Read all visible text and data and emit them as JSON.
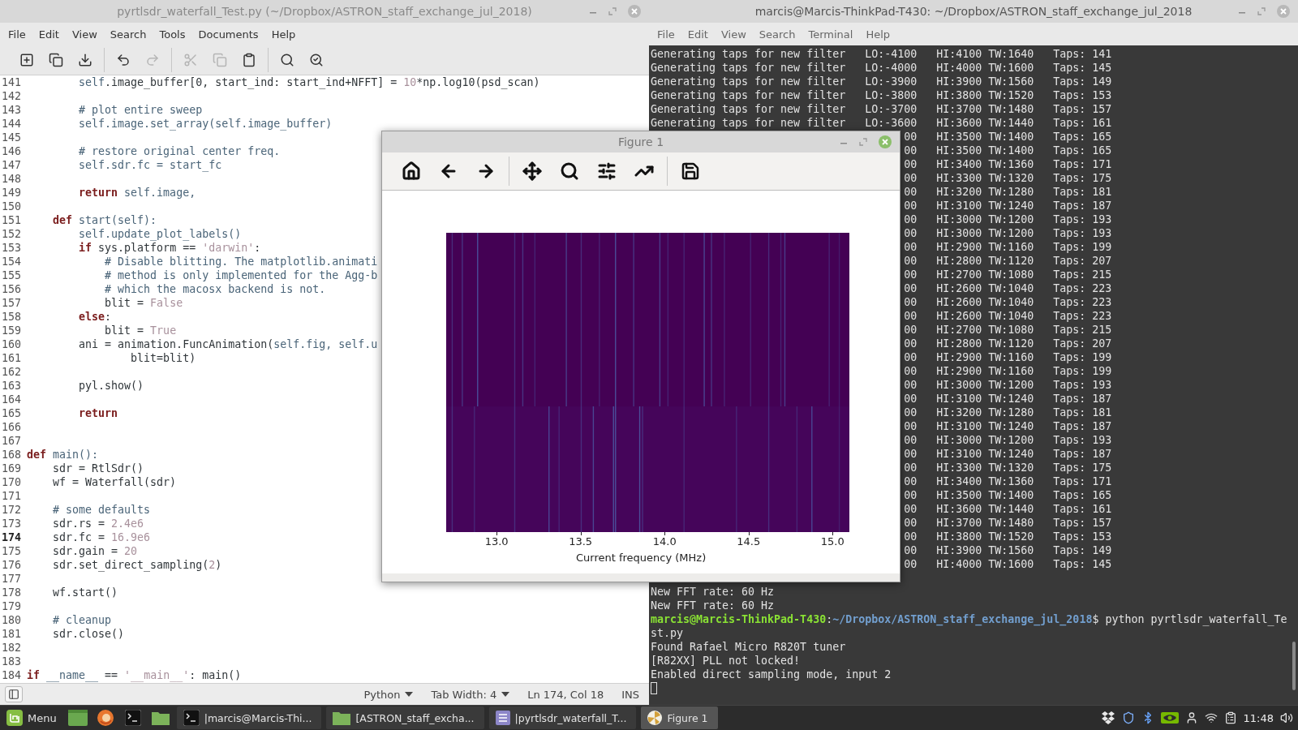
{
  "editor": {
    "title": "pyrtlsdr_waterfall_Test.py (~/Dropbox/ASTRON_staff_exchange_jul_2018)",
    "menu": [
      "File",
      "Edit",
      "View",
      "Search",
      "Tools",
      "Documents",
      "Help"
    ],
    "toolbar": [
      [
        {
          "kind": "new",
          "disabled": false
        },
        {
          "kind": "open",
          "disabled": false
        },
        {
          "kind": "save",
          "disabled": false
        }
      ],
      [
        {
          "kind": "undo",
          "disabled": false
        },
        {
          "kind": "redo",
          "disabled": true
        }
      ],
      [
        {
          "kind": "cut",
          "disabled": true
        },
        {
          "kind": "copy",
          "disabled": true
        },
        {
          "kind": "paste",
          "disabled": false
        }
      ],
      [
        {
          "kind": "search",
          "disabled": false
        },
        {
          "kind": "replace",
          "disabled": false
        }
      ]
    ],
    "lines": [
      {
        "n": "141",
        "current": false,
        "tokens": [
          {
            "kind": "name",
            "text": "        self"
          },
          {
            "kind": "plain",
            "text": ".image_buffer[0, start_ind: start_ind+NFFT] = "
          },
          {
            "kind": "literal",
            "text": "10"
          },
          {
            "kind": "plain",
            "text": "*np.log10(psd_scan)"
          }
        ]
      },
      {
        "n": "142",
        "current": false
      },
      {
        "n": "143",
        "current": false,
        "tokens": [
          {
            "kind": "comment",
            "text": "        # plot entire sweep"
          }
        ]
      },
      {
        "n": "144",
        "current": false,
        "tokens": [
          {
            "kind": "name",
            "text": "        self.image.set_array(self.image_buffer)"
          }
        ]
      },
      {
        "n": "145",
        "current": false
      },
      {
        "n": "146",
        "current": false,
        "tokens": [
          {
            "kind": "comment",
            "text": "        # restore original center freq."
          }
        ]
      },
      {
        "n": "147",
        "current": false,
        "tokens": [
          {
            "kind": "name",
            "text": "        self.sdr.fc = start_fc"
          }
        ]
      },
      {
        "n": "148",
        "current": false
      },
      {
        "n": "149",
        "current": false,
        "tokens": [
          {
            "kind": "keyword",
            "text": "        return"
          },
          {
            "kind": "name",
            "text": " self.image,"
          }
        ]
      },
      {
        "n": "150",
        "current": false
      },
      {
        "n": "151",
        "current": false,
        "tokens": [
          {
            "kind": "keyword",
            "text": "    def"
          },
          {
            "kind": "name",
            "text": " start(self):"
          }
        ]
      },
      {
        "n": "152",
        "current": false,
        "tokens": [
          {
            "kind": "name",
            "text": "        self.update_plot_labels()"
          }
        ]
      },
      {
        "n": "153",
        "current": false,
        "tokens": [
          {
            "kind": "keyword",
            "text": "        if"
          },
          {
            "kind": "plain",
            "text": " sys.platform == "
          },
          {
            "kind": "literal",
            "text": "'darwin'"
          },
          {
            "kind": "plain",
            "text": ":"
          }
        ]
      },
      {
        "n": "154",
        "current": false,
        "tokens": [
          {
            "kind": "comment",
            "text": "            # Disable blitting. The matplotlib.animati"
          }
        ]
      },
      {
        "n": "155",
        "current": false,
        "tokens": [
          {
            "kind": "comment",
            "text": "            # method is only implemented for the Agg-b"
          }
        ]
      },
      {
        "n": "156",
        "current": false,
        "tokens": [
          {
            "kind": "comment",
            "text": "            # which the macosx backend is not."
          }
        ]
      },
      {
        "n": "157",
        "current": false,
        "tokens": [
          {
            "kind": "plain",
            "text": "            blit = "
          },
          {
            "kind": "literal",
            "text": "False"
          }
        ]
      },
      {
        "n": "158",
        "current": false,
        "tokens": [
          {
            "kind": "keyword",
            "text": "        else"
          },
          {
            "kind": "plain",
            "text": ":"
          }
        ]
      },
      {
        "n": "159",
        "current": false,
        "tokens": [
          {
            "kind": "plain",
            "text": "            blit = "
          },
          {
            "kind": "literal",
            "text": "True"
          }
        ]
      },
      {
        "n": "160",
        "current": false,
        "tokens": [
          {
            "kind": "plain",
            "text": "        ani = animation.FuncAnimation("
          },
          {
            "kind": "name",
            "text": "self.fig, self.u"
          }
        ]
      },
      {
        "n": "161",
        "current": false,
        "tokens": [
          {
            "kind": "plain",
            "text": "                blit=blit)"
          }
        ]
      },
      {
        "n": "162",
        "current": false
      },
      {
        "n": "163",
        "current": false,
        "tokens": [
          {
            "kind": "plain",
            "text": "        pyl.show()"
          }
        ]
      },
      {
        "n": "164",
        "current": false
      },
      {
        "n": "165",
        "current": false,
        "tokens": [
          {
            "kind": "keyword",
            "text": "        return"
          }
        ]
      },
      {
        "n": "166",
        "current": false
      },
      {
        "n": "167",
        "current": false
      },
      {
        "n": "168",
        "current": false,
        "tokens": [
          {
            "kind": "keyword",
            "text": "def"
          },
          {
            "kind": "name",
            "text": " main():"
          }
        ]
      },
      {
        "n": "169",
        "current": false,
        "tokens": [
          {
            "kind": "plain",
            "text": "    sdr = RtlSdr()"
          }
        ]
      },
      {
        "n": "170",
        "current": false,
        "tokens": [
          {
            "kind": "plain",
            "text": "    wf = Waterfall(sdr)"
          }
        ]
      },
      {
        "n": "171",
        "current": false
      },
      {
        "n": "172",
        "current": false,
        "tokens": [
          {
            "kind": "comment",
            "text": "    # some defaults"
          }
        ]
      },
      {
        "n": "173",
        "current": false,
        "tokens": [
          {
            "kind": "plain",
            "text": "    sdr.rs = "
          },
          {
            "kind": "literal",
            "text": "2.4e6"
          }
        ]
      },
      {
        "n": "174",
        "current": true,
        "tokens": [
          {
            "kind": "plain",
            "text": "    sdr.fc = "
          },
          {
            "kind": "literal",
            "text": "16.9e6"
          }
        ]
      },
      {
        "n": "175",
        "current": false,
        "tokens": [
          {
            "kind": "plain",
            "text": "    sdr.gain = "
          },
          {
            "kind": "literal",
            "text": "20"
          }
        ]
      },
      {
        "n": "176",
        "current": false,
        "tokens": [
          {
            "kind": "plain",
            "text": "    sdr.set_direct_sampling("
          },
          {
            "kind": "literal",
            "text": "2"
          },
          {
            "kind": "plain",
            "text": ")"
          }
        ]
      },
      {
        "n": "177",
        "current": false
      },
      {
        "n": "178",
        "current": false,
        "tokens": [
          {
            "kind": "plain",
            "text": "    wf.start()"
          }
        ]
      },
      {
        "n": "179",
        "current": false
      },
      {
        "n": "180",
        "current": false,
        "tokens": [
          {
            "kind": "comment",
            "text": "    # cleanup"
          }
        ]
      },
      {
        "n": "181",
        "current": false,
        "tokens": [
          {
            "kind": "plain",
            "text": "    sdr.close()"
          }
        ]
      },
      {
        "n": "182",
        "current": false
      },
      {
        "n": "183",
        "current": false
      },
      {
        "n": "184",
        "current": false,
        "tokens": [
          {
            "kind": "keyword",
            "text": "if"
          },
          {
            "kind": "name",
            "text": " __name__"
          },
          {
            "kind": "plain",
            "text": " == "
          },
          {
            "kind": "literal",
            "text": "'__main__'"
          },
          {
            "kind": "plain",
            "text": ": main()"
          }
        ]
      }
    ],
    "status": {
      "language": "Python",
      "tab_width": "Tab Width: 4",
      "position": "Ln 174, Col 18",
      "mode": "INS"
    }
  },
  "terminal": {
    "title": "marcis@Marcis-ThinkPad-T430: ~/Dropbox/ASTRON_staff_exchange_jul_2018",
    "menu": [
      "File",
      "Edit",
      "View",
      "Search",
      "Terminal",
      "Help"
    ],
    "filter_rows": [
      {
        "message": "Generating taps for new filter",
        "lo": "LO:-4100",
        "hi": "HI:4100",
        "tw": "TW:1640",
        "taps": "Taps: 141"
      },
      {
        "message": "Generating taps for new filter",
        "lo": "LO:-4000",
        "hi": "HI:4000",
        "tw": "TW:1600",
        "taps": "Taps: 145"
      },
      {
        "message": "Generating taps for new filter",
        "lo": "LO:-3900",
        "hi": "HI:3900",
        "tw": "TW:1560",
        "taps": "Taps: 149"
      },
      {
        "message": "Generating taps for new filter",
        "lo": "LO:-3800",
        "hi": "HI:3800",
        "tw": "TW:1520",
        "taps": "Taps: 153"
      },
      {
        "message": "Generating taps for new filter",
        "lo": "LO:-3700",
        "hi": "HI:3700",
        "tw": "TW:1480",
        "taps": "Taps: 157"
      },
      {
        "message": "Generating taps for new filter",
        "lo": "LO:-3600",
        "hi": "HI:3600",
        "tw": "TW:1440",
        "taps": "Taps: 161"
      },
      {
        "lo": "00",
        "hi": "HI:3500",
        "tw": "TW:1400",
        "taps": "Taps: 165"
      },
      {
        "lo": "00",
        "hi": "HI:3500",
        "tw": "TW:1400",
        "taps": "Taps: 165"
      },
      {
        "lo": "00",
        "hi": "HI:3400",
        "tw": "TW:1360",
        "taps": "Taps: 171"
      },
      {
        "lo": "00",
        "hi": "HI:3300",
        "tw": "TW:1320",
        "taps": "Taps: 175"
      },
      {
        "lo": "00",
        "hi": "HI:3200",
        "tw": "TW:1280",
        "taps": "Taps: 181"
      },
      {
        "lo": "00",
        "hi": "HI:3100",
        "tw": "TW:1240",
        "taps": "Taps: 187"
      },
      {
        "lo": "00",
        "hi": "HI:3000",
        "tw": "TW:1200",
        "taps": "Taps: 193"
      },
      {
        "lo": "00",
        "hi": "HI:3000",
        "tw": "TW:1200",
        "taps": "Taps: 193"
      },
      {
        "lo": "00",
        "hi": "HI:2900",
        "tw": "TW:1160",
        "taps": "Taps: 199"
      },
      {
        "lo": "00",
        "hi": "HI:2800",
        "tw": "TW:1120",
        "taps": "Taps: 207"
      },
      {
        "lo": "00",
        "hi": "HI:2700",
        "tw": "TW:1080",
        "taps": "Taps: 215"
      },
      {
        "lo": "00",
        "hi": "HI:2600",
        "tw": "TW:1040",
        "taps": "Taps: 223"
      },
      {
        "lo": "00",
        "hi": "HI:2600",
        "tw": "TW:1040",
        "taps": "Taps: 223"
      },
      {
        "lo": "00",
        "hi": "HI:2600",
        "tw": "TW:1040",
        "taps": "Taps: 223"
      },
      {
        "lo": "00",
        "hi": "HI:2700",
        "tw": "TW:1080",
        "taps": "Taps: 215"
      },
      {
        "lo": "00",
        "hi": "HI:2800",
        "tw": "TW:1120",
        "taps": "Taps: 207"
      },
      {
        "lo": "00",
        "hi": "HI:2900",
        "tw": "TW:1160",
        "taps": "Taps: 199"
      },
      {
        "lo": "00",
        "hi": "HI:2900",
        "tw": "TW:1160",
        "taps": "Taps: 199"
      },
      {
        "lo": "00",
        "hi": "HI:3000",
        "tw": "TW:1200",
        "taps": "Taps: 193"
      },
      {
        "lo": "00",
        "hi": "HI:3100",
        "tw": "TW:1240",
        "taps": "Taps: 187"
      },
      {
        "lo": "00",
        "hi": "HI:3200",
        "tw": "TW:1280",
        "taps": "Taps: 181"
      },
      {
        "lo": "00",
        "hi": "HI:3100",
        "tw": "TW:1240",
        "taps": "Taps: 187"
      },
      {
        "lo": "00",
        "hi": "HI:3000",
        "tw": "TW:1200",
        "taps": "Taps: 193"
      },
      {
        "lo": "00",
        "hi": "HI:3100",
        "tw": "TW:1240",
        "taps": "Taps: 187"
      },
      {
        "lo": "00",
        "hi": "HI:3300",
        "tw": "TW:1320",
        "taps": "Taps: 175"
      },
      {
        "lo": "00",
        "hi": "HI:3400",
        "tw": "TW:1360",
        "taps": "Taps: 171"
      },
      {
        "lo": "00",
        "hi": "HI:3500",
        "tw": "TW:1400",
        "taps": "Taps: 165"
      },
      {
        "lo": "00",
        "hi": "HI:3600",
        "tw": "TW:1440",
        "taps": "Taps: 161"
      },
      {
        "lo": "00",
        "hi": "HI:3700",
        "tw": "TW:1480",
        "taps": "Taps: 157"
      },
      {
        "lo": "00",
        "hi": "HI:3800",
        "tw": "TW:1520",
        "taps": "Taps: 153"
      },
      {
        "lo": "00",
        "hi": "HI:3900",
        "tw": "TW:1560",
        "taps": "Taps: 149"
      },
      {
        "lo": "00",
        "hi": "HI:4000",
        "tw": "TW:1600",
        "taps": "Taps: 145"
      }
    ],
    "lines": [
      {
        "kind": "output",
        "text": "New FFT rate: 60 Hz"
      },
      {
        "kind": "output",
        "text": "New FFT rate: 60 Hz"
      },
      {
        "kind": "prompt",
        "user": "marcis@Marcis-ThinkPad-T430",
        "separator": ":",
        "path": "~/Dropbox/ASTRON_staff_exchange_jul_2018",
        "command": "$ python pyrtlsdr_waterfall_Te"
      },
      {
        "kind": "output",
        "text": "st.py"
      },
      {
        "kind": "output",
        "text": "Found Rafael Micro R820T tuner"
      },
      {
        "kind": "output",
        "text": "[R82XX] PLL not locked!"
      },
      {
        "kind": "output",
        "text": "Enabled direct sampling mode, input 2"
      },
      {
        "kind": "cursor"
      }
    ]
  },
  "figure": {
    "title": "Figure 1",
    "toolbar": [
      [
        {
          "kind": "home"
        },
        {
          "kind": "back"
        },
        {
          "kind": "forward"
        }
      ],
      [
        {
          "kind": "pan"
        },
        {
          "kind": "zoom"
        },
        {
          "kind": "configure"
        },
        {
          "kind": "edit"
        }
      ],
      [
        {
          "kind": "save"
        }
      ]
    ],
    "xticks": [
      "13.0",
      "13.5",
      "14.0",
      "14.5",
      "15.0"
    ],
    "xlabel": "Current frequency (MHz)"
  },
  "taskbar": {
    "menu_label": "Menu",
    "launchers": [
      {
        "kind": "desktop"
      },
      {
        "kind": "browser"
      },
      {
        "kind": "terminal"
      },
      {
        "kind": "folder"
      }
    ],
    "windows": [
      {
        "kind": "terminal",
        "label": "|marcis@Marcis-Thi...",
        "selected": false
      },
      {
        "kind": "folder",
        "label": "[ASTRON_staff_excha...",
        "selected": false
      },
      {
        "kind": "editor",
        "label": "|pyrtlsdr_waterfall_T...",
        "selected": false
      },
      {
        "kind": "figure",
        "label": "Figure 1",
        "selected": true
      }
    ],
    "tray": [
      {
        "kind": "dropbox"
      },
      {
        "kind": "shield"
      },
      {
        "kind": "bluetooth"
      },
      {
        "kind": "gpu"
      },
      {
        "kind": "user"
      },
      {
        "kind": "wifi"
      },
      {
        "kind": "clipboard"
      }
    ],
    "clock": "11:48",
    "volume": {
      "kind": "volume"
    }
  }
}
